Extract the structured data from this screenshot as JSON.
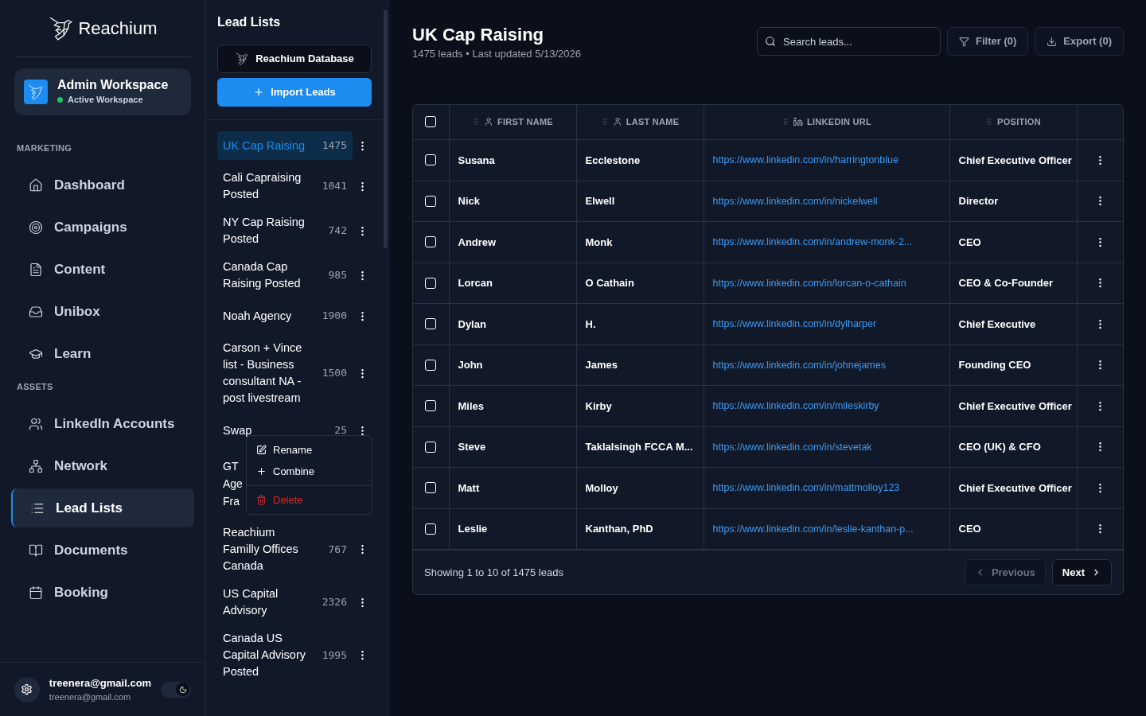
{
  "brand": {
    "name": "Reachium"
  },
  "workspace": {
    "name": "Admin Workspace",
    "status": "Active Workspace",
    "active": true
  },
  "nav_sections": [
    {
      "title": "MARKETING",
      "items": [
        {
          "label": "Dashboard",
          "selected": false
        },
        {
          "label": "Campaigns",
          "selected": false
        },
        {
          "label": "Content",
          "selected": false
        },
        {
          "label": "Unibox",
          "selected": false
        },
        {
          "label": "Learn",
          "selected": false
        }
      ]
    },
    {
      "title": "ASSETS",
      "items": [
        {
          "label": "LinkedIn Accounts",
          "selected": false
        },
        {
          "label": "Network",
          "selected": false
        },
        {
          "label": "Lead Lists",
          "selected": true
        },
        {
          "label": "Documents",
          "selected": false
        },
        {
          "label": "Booking",
          "selected": false
        }
      ]
    }
  ],
  "user": {
    "email": "treenera@gmail.com",
    "subtitle": "treenera@gmail.com",
    "dark_mode": true
  },
  "lead_lists": {
    "title": "Lead Lists",
    "database_button": "Reachium Database",
    "import_button": "Import Leads",
    "items": [
      {
        "name": "UK Cap Raising",
        "count": "1475",
        "selected": true
      },
      {
        "name": "Cali Capraising Posted",
        "count": "1041",
        "selected": false
      },
      {
        "name": "NY Cap Raising Posted",
        "count": "742",
        "selected": false
      },
      {
        "name": "Canada Cap Raising Posted",
        "count": "985",
        "selected": false
      },
      {
        "name": "Noah Agency",
        "count": "1900",
        "selected": false
      },
      {
        "name": "Carson + Vince list - Business consultant NA - post livestream",
        "count": "1500",
        "selected": false
      },
      {
        "name": "Swap",
        "count": "25",
        "selected": false,
        "menu": [
          {
            "label": "Rename",
            "kind": "edit"
          },
          {
            "label": "Combine",
            "kind": "plus"
          },
          {
            "label": "Delete",
            "kind": "danger"
          }
        ]
      },
      {
        "name": "GT\nAge\nFra",
        "selected": false
      },
      {
        "name": "Reachium Familly Offices Canada",
        "count": "767",
        "selected": false
      },
      {
        "name": "US Capital Advisory",
        "count": "2326",
        "selected": false
      },
      {
        "name": "Canada US Capital Advisory Posted",
        "count": "1995",
        "selected": false
      }
    ]
  },
  "main": {
    "title": "UK Cap Raising",
    "subtitle": "1475 leads • Last updated 5/13/2026",
    "search": {
      "placeholder": "Search leads..."
    },
    "filter_button": "Filter (0)",
    "export_button": "Export (0)"
  },
  "table": {
    "select_all": false,
    "columns": [
      {
        "label": "FIRST NAME"
      },
      {
        "label": "LAST NAME"
      },
      {
        "label": "LINKEDIN URL"
      },
      {
        "label": "POSITION"
      }
    ],
    "rows": [
      {
        "checked": false,
        "first": "Susana",
        "last": "Ecclestone",
        "url": "https://www.linkedin.com/in/harringtonblue",
        "position": "Chief Executive Officer"
      },
      {
        "checked": false,
        "first": "Nick",
        "last": "Elwell",
        "url": "https://www.linkedin.com/in/nickelwell",
        "position": "Director"
      },
      {
        "checked": false,
        "first": "Andrew",
        "last": "Monk",
        "url": "https://www.linkedin.com/in/andrew-monk-2...",
        "position": "CEO"
      },
      {
        "checked": false,
        "first": "Lorcan",
        "last": "O Cathain",
        "url": "https://www.linkedin.com/in/lorcan-o-cathain",
        "position": "CEO & Co-Founder"
      },
      {
        "checked": false,
        "first": "Dylan",
        "last": "H.",
        "url": "https://www.linkedin.com/in/dylharper",
        "position": "Chief Executive"
      },
      {
        "checked": false,
        "first": "John",
        "last": "James",
        "url": "https://www.linkedin.com/in/johnejames",
        "position": "Founding CEO"
      },
      {
        "checked": false,
        "first": "Miles",
        "last": "Kirby",
        "url": "https://www.linkedin.com/in/mileskirby",
        "position": "Chief Executive Officer"
      },
      {
        "checked": false,
        "first": "Steve",
        "last": "Taklalsingh FCCA M...",
        "url": "https://www.linkedin.com/in/stevetak",
        "position": "CEO (UK) & CFO"
      },
      {
        "checked": false,
        "first": "Matt",
        "last": "Molloy",
        "url": "https://www.linkedin.com/in/mattmolloy123",
        "position": "Chief Executive Officer"
      },
      {
        "checked": false,
        "first": "Leslie",
        "last": "Kanthan, PhD",
        "url": "https://www.linkedin.com/in/leslie-kanthan-p...",
        "position": "CEO"
      }
    ]
  },
  "pagination": {
    "summary": "Showing 1 to 10 of 1475 leads",
    "previous": {
      "label": "Previous",
      "disabled": true
    },
    "next": {
      "label": "Next",
      "disabled": false
    }
  }
}
